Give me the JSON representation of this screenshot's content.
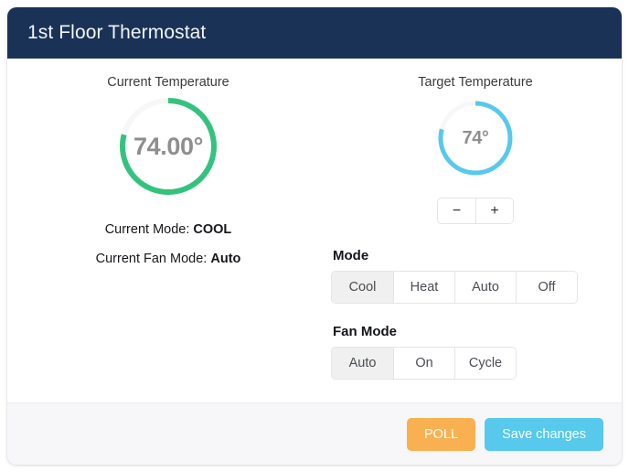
{
  "header": {
    "title": "1st Floor Thermostat"
  },
  "current": {
    "caption": "Current Temperature",
    "value": "74.00°",
    "arc_color": "#34c37f",
    "track_color": "#f7f7f7",
    "arc_percent": 79,
    "mode_label": "Current Mode:",
    "mode_value": "COOL",
    "fan_label": "Current Fan Mode:",
    "fan_value": "Auto"
  },
  "target": {
    "caption": "Target Temperature",
    "value": "74°",
    "arc_color": "#56c9ec",
    "track_color": "#f7f7f7",
    "arc_percent": 79,
    "stepper": {
      "decrease_label": "−",
      "increase_label": "+"
    }
  },
  "mode": {
    "label": "Mode",
    "options": [
      "Cool",
      "Heat",
      "Auto",
      "Off"
    ],
    "selected": "Cool"
  },
  "fan_mode": {
    "label": "Fan Mode",
    "options": [
      "Auto",
      "On",
      "Cycle"
    ],
    "selected": "Auto"
  },
  "footer": {
    "poll_label": "POLL",
    "save_label": "Save changes",
    "poll_color": "#f9b050",
    "save_color": "#56c9ec"
  }
}
